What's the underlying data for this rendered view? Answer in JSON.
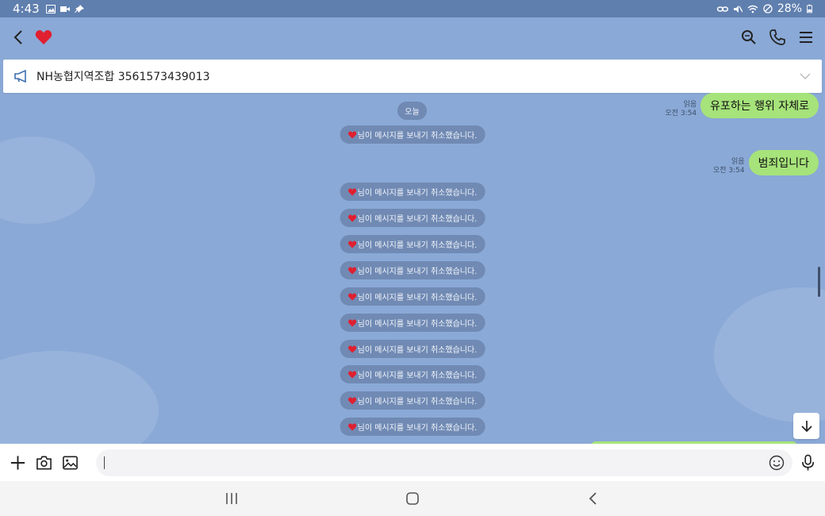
{
  "status_bar": {
    "time": "4:43",
    "battery": "28%"
  },
  "header": {
    "contact_emoji": "❤️"
  },
  "notice": {
    "text": "NH농협지역조합 3561573439013"
  },
  "date_divider": "오늘",
  "system_message": "님이 메시지를 보내기 취소했습니다.",
  "messages": [
    {
      "read": "읽음",
      "time": "오전 3:54",
      "text": "유포하는 행위 자체로"
    },
    {
      "read": "읽음",
      "time": "오전 3:54",
      "text": "범죄입니다"
    }
  ],
  "colors": {
    "chat_bg": "#8aa9d6",
    "bubble": "#a6e37a",
    "status_bar": "#5f7fae"
  },
  "icons": [
    "back-icon",
    "heart-icon",
    "search-icon",
    "phone-icon",
    "menu-icon",
    "megaphone-icon",
    "chevron-down-icon",
    "plus-icon",
    "camera-icon",
    "image-icon",
    "emoji-icon",
    "mic-icon",
    "arrow-down-icon",
    "recents-icon",
    "home-icon",
    "nav-back-icon"
  ]
}
